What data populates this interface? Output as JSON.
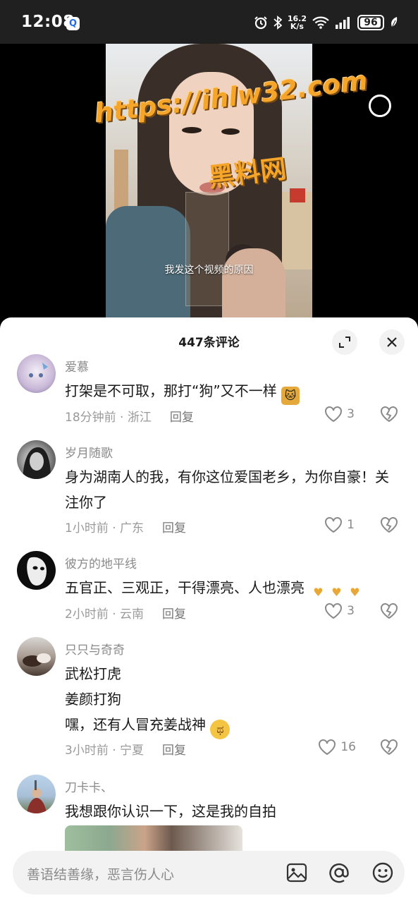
{
  "status_bar": {
    "time": "12:08",
    "app_icon_glyph": "Q",
    "net_speed_value": "16.2",
    "net_speed_unit": "K/s",
    "battery_level": "96",
    "battery_fraction": 0.96,
    "icons": [
      "alarm-icon",
      "bluetooth-icon",
      "wifi-icon",
      "signal-icon",
      "battery-icon",
      "leaf-icon"
    ]
  },
  "video": {
    "subtitle": "我发这个视频的原因",
    "watermark_url": "https://ihlw32.com",
    "watermark_name": "黑料网"
  },
  "comments_panel": {
    "title": "447条评论",
    "expand_icon": "expand-icon",
    "close_icon": "close-icon",
    "comments": [
      {
        "user": "爱慕",
        "text": "打架是不可取，那打“狗”又不一样",
        "time": "18分钟前 · 浙江",
        "reply": "回复",
        "likes": "3"
      },
      {
        "user": "岁月随歌",
        "text": "身为湖南人的我，有你这位爱国老乡，为你自豪！关注你了",
        "time": "1小时前 · 广东",
        "reply": "回复",
        "likes": "1"
      },
      {
        "user": "彼方的地平线",
        "text": "五官正、三观正，干得漂亮、人也漂亮",
        "time": "2小时前 · 云南",
        "reply": "回复",
        "likes": "3"
      },
      {
        "user": "只只与奇奇",
        "line1": "武松打虎",
        "line2": "姜颜打狗",
        "line3": "嘿，还有人冒充姜战神",
        "time": "3小时前 · 宁夏",
        "reply": "回复",
        "likes": "16"
      },
      {
        "user": "刀卡卡、",
        "text": "我想跟你认识一下，这是我的自拍"
      }
    ]
  },
  "input_bar": {
    "placeholder": "善语结善缘，恶言伤人心",
    "icons": [
      "image-icon",
      "at-icon",
      "emoji-icon"
    ]
  },
  "colors": {
    "status_bar_bg": "#202020",
    "watermark": "#f5a52a",
    "sheet_bg": "#ffffff",
    "muted_text": "#8a8a8a",
    "input_bg": "#f2f2f2"
  }
}
